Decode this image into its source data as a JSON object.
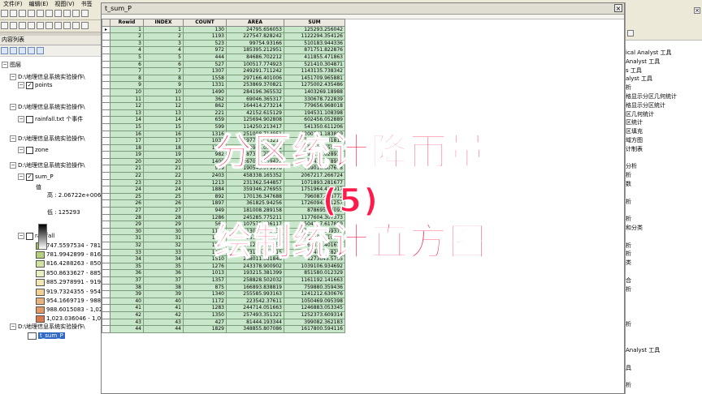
{
  "menubar": {
    "items": [
      "文件(F)",
      "编辑(E)",
      "视图(V)",
      "书签"
    ]
  },
  "toc": {
    "title": "内容列表",
    "rows": [
      {
        "label": "图层",
        "type": "group",
        "indent": 2
      },
      {
        "label": "D:\\地理信息系统实验操作\\",
        "type": "path",
        "indent": 12
      },
      {
        "label": "points",
        "type": "layer",
        "checked": true,
        "indent": 22
      },
      {
        "label": "D:\\地理信息系统实验操作\\",
        "type": "path",
        "indent": 12
      },
      {
        "label": "rainfall.txt 个事件",
        "type": "layer",
        "checked": false,
        "indent": 22
      },
      {
        "label": "D:\\地理信息系统实验操作\\",
        "type": "path",
        "indent": 12
      },
      {
        "label": "zone",
        "type": "layer",
        "checked": false,
        "indent": 22
      },
      {
        "label": "D:\\地理信息系统实验操作\\",
        "type": "path",
        "indent": 12
      },
      {
        "label": "sum_P",
        "type": "layer",
        "checked": true,
        "indent": 22
      },
      {
        "label": "值",
        "type": "text",
        "indent": 44
      },
      {
        "label": "高 : 2.06722e+006",
        "type": "text",
        "indent": 58
      },
      {
        "label": "低 : 125293",
        "type": "text",
        "indent": 58
      },
      {
        "label": "rainfall",
        "type": "layer",
        "checked": false,
        "indent": 22
      },
      {
        "label": "747.5597534 - 781",
        "type": "class",
        "color": "#9bbb59",
        "indent": 44
      },
      {
        "label": "781.9942899 - 816",
        "type": "class",
        "color": "#b6cf7c",
        "indent": 44
      },
      {
        "label": "816.4288263 - 850",
        "type": "class",
        "color": "#d1e3a0",
        "indent": 44
      },
      {
        "label": "850.8633627 - 885",
        "type": "class",
        "color": "#e8efc0",
        "indent": 44
      },
      {
        "label": "885.2978991 - 919",
        "type": "class",
        "color": "#f3e7b0",
        "indent": 44
      },
      {
        "label": "919.7324355 - 954",
        "type": "class",
        "color": "#f1cf95",
        "indent": 44
      },
      {
        "label": "954.1669719 - 988",
        "type": "class",
        "color": "#eab27d",
        "indent": 44
      },
      {
        "label": "988.6015083 - 1,02",
        "type": "class",
        "color": "#e29867",
        "indent": 44
      },
      {
        "label": "1,023.036046 - 1,0",
        "type": "class",
        "color": "#d9794f",
        "indent": 44
      },
      {
        "label": "D:\\地理信息系统实验操作\\",
        "type": "path",
        "indent": 12
      },
      {
        "label": "t_sum_P",
        "type": "table",
        "selected": true,
        "indent": 34
      }
    ]
  },
  "table_window": {
    "title": "t_sum_P",
    "columns": [
      "Rowid",
      "INDEX",
      "COUNT",
      "AREA",
      "SUM"
    ],
    "rows": [
      [
        "1",
        "1",
        "130",
        "24795.656053",
        "125293.256042"
      ],
      [
        "2",
        "2",
        "1193",
        "227547.828242",
        "1122294.354126"
      ],
      [
        "3",
        "3",
        "523",
        "99754.93166",
        "510183.944336"
      ],
      [
        "4",
        "4",
        "972",
        "185395.212951",
        "871751.822876"
      ],
      [
        "5",
        "5",
        "444",
        "84686.702212",
        "411855.471863"
      ],
      [
        "6",
        "6",
        "527",
        "100517.774923",
        "521410.304871"
      ],
      [
        "7",
        "7",
        "1307",
        "249291.711242",
        "1143135.738342"
      ],
      [
        "8",
        "8",
        "1558",
        "297166.401006",
        "1451709.965881"
      ],
      [
        "9",
        "9",
        "1331",
        "253869.370821",
        "1275002.435486"
      ],
      [
        "10",
        "10",
        "1490",
        "284196.365532",
        "1403269.18988"
      ],
      [
        "11",
        "11",
        "362",
        "69046.365317",
        "330678.722839"
      ],
      [
        "12",
        "12",
        "862",
        "164414.273214",
        "779656.968018"
      ],
      [
        "13",
        "13",
        "221",
        "42152.615129",
        "194531.108398"
      ],
      [
        "14",
        "14",
        "659",
        "125694.902808",
        "602456.052889"
      ],
      [
        "15",
        "15",
        "599",
        "114250.213417",
        "541350.611206"
      ],
      [
        "16",
        "16",
        "1316",
        "251008.714951",
        "1200551.183899"
      ],
      [
        "17",
        "17",
        "1037",
        "197794.013211",
        "946200.231812"
      ],
      [
        "18",
        "18",
        "1258",
        "239945.096921",
        "1158921.655945"
      ],
      [
        "19",
        "19",
        "982",
        "187302.252063",
        "890135.028931"
      ],
      [
        "20",
        "20",
        "1400",
        "267030.159422",
        "1285430.178955"
      ],
      [
        "21",
        "21",
        "999",
        "190545.079978",
        "939016.807678"
      ],
      [
        "22",
        "22",
        "2403",
        "458338.165352",
        "2067217.266724"
      ],
      [
        "23",
        "23",
        "1213",
        "231362.544857",
        "1071893.281677"
      ],
      [
        "24",
        "24",
        "1884",
        "359346.276955",
        "1751964.427917"
      ],
      [
        "25",
        "25",
        "892",
        "170136.347688",
        "796087.428772"
      ],
      [
        "26",
        "26",
        "1897",
        "361825.94256",
        "1726094.351257"
      ],
      [
        "27",
        "27",
        "949",
        "181008.289158",
        "878695.64093"
      ],
      [
        "28",
        "28",
        "1286",
        "245285.775211",
        "1177604.307373"
      ],
      [
        "29",
        "29",
        "564",
        "107575.036117",
        "504317.617859"
      ],
      [
        "30",
        "30",
        "1117",
        "213050.452438",
        "1011658.549377"
      ],
      [
        "31",
        "31",
        "1233",
        "235176.814211",
        "1130267.110779"
      ],
      [
        "32",
        "32",
        "1055",
        "201227.229451",
        "964338.401672"
      ],
      [
        "33",
        "33",
        "1432",
        "273133.646915",
        "1312480.028259"
      ],
      [
        "34",
        "34",
        "1510",
        "288011.081848",
        "1273645.5755"
      ],
      [
        "35",
        "35",
        "1276",
        "243378.900902",
        "1039106.934692"
      ],
      [
        "36",
        "36",
        "1013",
        "193215.381399",
        "851580.012329"
      ],
      [
        "37",
        "37",
        "1357",
        "258828.502032",
        "1161192.141663"
      ],
      [
        "38",
        "38",
        "875",
        "166893.838819",
        "759880.359436"
      ],
      [
        "39",
        "39",
        "1340",
        "255585.993163",
        "1241212.630676"
      ],
      [
        "40",
        "40",
        "1172",
        "223542.37611",
        "1050469.095398"
      ],
      [
        "41",
        "41",
        "1283",
        "244714.051663",
        "1246883.053345"
      ],
      [
        "42",
        "42",
        "1350",
        "257493.351321",
        "1252373.609314"
      ],
      [
        "43",
        "43",
        "427",
        "81444.193344",
        "399082.362183"
      ],
      [
        "44",
        "44",
        "1829",
        "348855.807086",
        "1617800.594116"
      ]
    ]
  },
  "right_panel": {
    "items": [
      "ical Analyst 工具",
      "Analyst 工具",
      "s 工具",
      "alyst 工具",
      "析",
      "格显示分区几何统计",
      "格显示分区统计",
      "区几何统计",
      "区统计",
      "区填充",
      "域方图",
      "计制表",
      "",
      "分析",
      "析",
      "数",
      "",
      "析",
      "",
      "析",
      "和分类",
      "",
      "析",
      "析",
      "类",
      "",
      "合",
      "析",
      "",
      "",
      "",
      "析",
      "",
      "",
      "Analyst 工具",
      "",
      "具",
      "",
      "析"
    ]
  },
  "overlay": {
    "line1": "分区统计降雨量",
    "line2": "(5)",
    "line3": "绘制统计直方图"
  }
}
